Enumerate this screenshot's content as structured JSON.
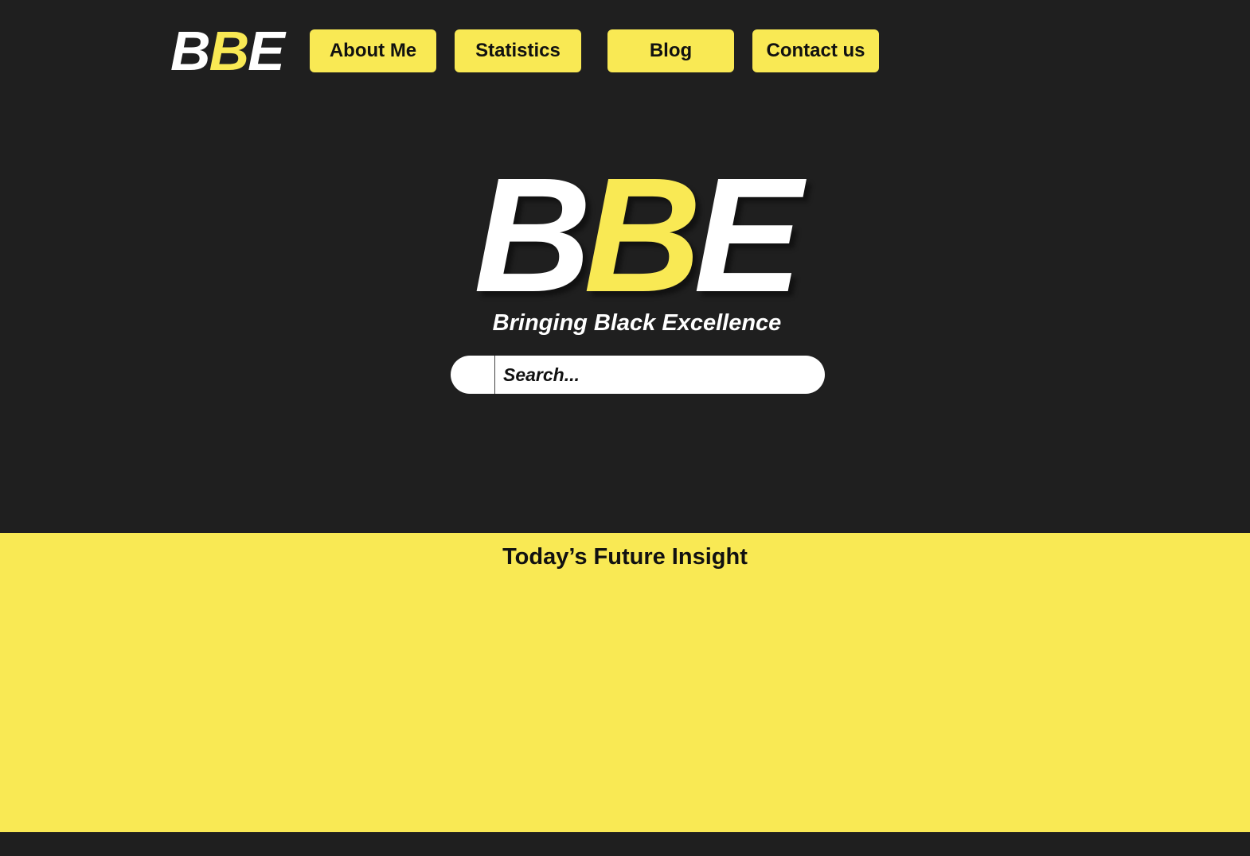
{
  "header": {
    "logo": {
      "part1": "B",
      "part2": "B",
      "part3": "E"
    },
    "nav": [
      {
        "label": "About Me"
      },
      {
        "label": "Statistics"
      },
      {
        "label": "Blog"
      },
      {
        "label": "Contact us"
      }
    ]
  },
  "hero": {
    "logo": {
      "part1": "B",
      "part2": "B",
      "part3": "E"
    },
    "tagline": "Bringing Black Excellence",
    "search": {
      "placeholder": "Search..."
    }
  },
  "insight": {
    "title": "Today’s Future Insight"
  },
  "colors": {
    "background": "#1f1f1f",
    "accent": "#f9e954",
    "text_dark": "#111111",
    "text_light": "#ffffff"
  }
}
